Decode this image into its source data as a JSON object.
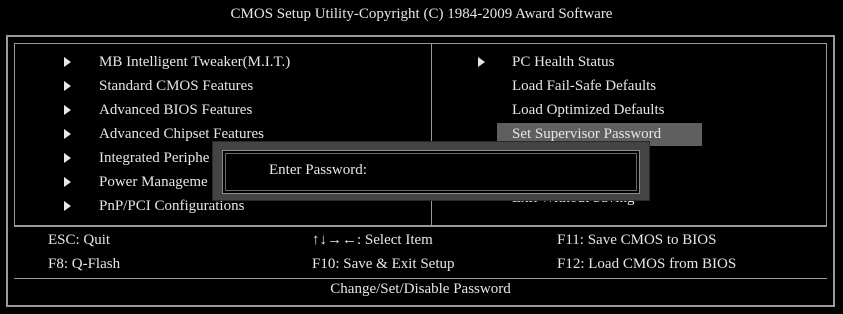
{
  "title": "CMOS Setup Utility-Copyright (C) 1984-2009 Award Software",
  "left_menu": [
    "MB Intelligent Tweaker(M.I.T.)",
    "Standard CMOS Features",
    "Advanced BIOS Features",
    "Advanced Chipset Features",
    "Integrated Periphe",
    "Power Manageme",
    "PnP/PCI Configurations"
  ],
  "right_menu": {
    "first": "PC Health Status",
    "items": [
      "Load Fail-Safe Defaults",
      "Load Optimized Defaults",
      "Set Supervisor Password"
    ],
    "obscured_last": "Exit Without Saving"
  },
  "keys": {
    "esc": "ESC: Quit",
    "nav": "↑↓→←: Select Item",
    "f11": "F11: Save CMOS to BIOS",
    "f8": "F8: Q-Flash",
    "f10": "F10: Save & Exit Setup",
    "f12": "F12: Load CMOS from BIOS"
  },
  "status": "Change/Set/Disable Password",
  "dialog": {
    "prompt": "Enter Password:"
  },
  "colors": {
    "background": "#000000",
    "text": "#e6e6e6",
    "border": "#9a9a9a",
    "highlight": "#5f5f5f",
    "dialog": "#444444"
  }
}
